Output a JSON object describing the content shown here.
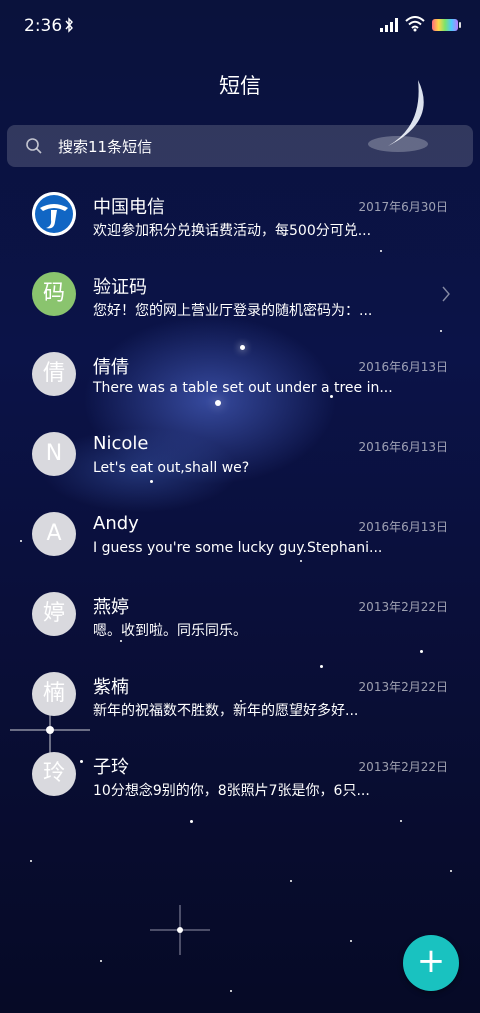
{
  "status_bar": {
    "time": "2:36"
  },
  "header": {
    "title": "短信"
  },
  "search": {
    "placeholder": "搜索11条短信"
  },
  "conversations": [
    {
      "name": "中国电信",
      "date": "2017年6月30日",
      "preview": "欢迎参加积分兑换话费活动，每500分可兑...",
      "avatar": "telecom-logo"
    },
    {
      "name": "验证码",
      "date": "",
      "preview": "您好！您的网上营业厅登录的随机密码为：...",
      "avatar": "码"
    },
    {
      "name": "倩倩",
      "date": "2016年6月13日",
      "preview": "There was a table set out under a tree in...",
      "avatar": "倩"
    },
    {
      "name": "Nicole",
      "date": "2016年6月13日",
      "preview": "Let's eat out,shall we?",
      "avatar": "N"
    },
    {
      "name": "Andy",
      "date": "2016年6月13日",
      "preview": "I guess you're some lucky guy.Stephani...",
      "avatar": "A"
    },
    {
      "name": "燕婷",
      "date": "2013年2月22日",
      "preview": "嗯。收到啦。同乐同乐。",
      "avatar": "婷"
    },
    {
      "name": "紫楠",
      "date": "2013年2月22日",
      "preview": "新年的祝福数不胜数，新年的愿望好多好...",
      "avatar": "楠"
    },
    {
      "name": "子玲",
      "date": "2013年2月22日",
      "preview": "10分想念9别的你，8张照片7张是你，6只...",
      "avatar": "玲"
    }
  ],
  "fab": {
    "label": "+"
  },
  "colors": {
    "fab": "#19c2c0",
    "background": "#0b1348",
    "verification_avatar": "#8ac46e"
  }
}
